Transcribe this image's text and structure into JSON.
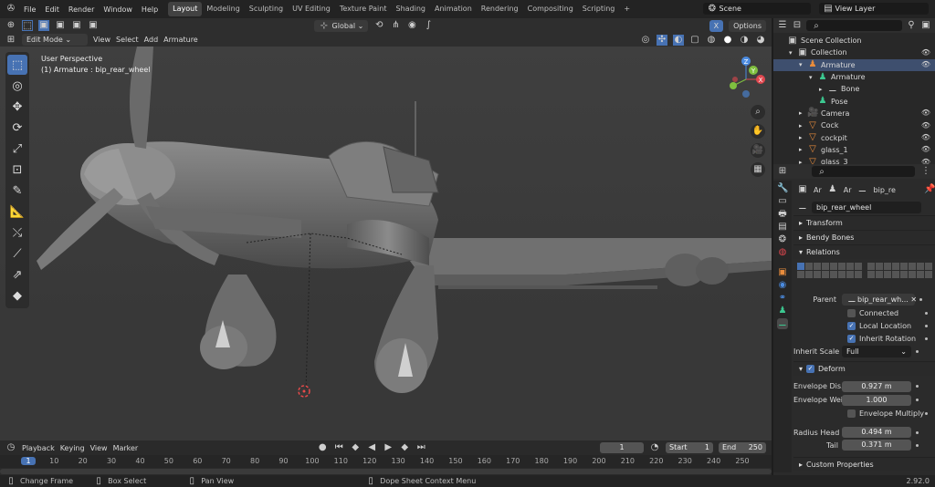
{
  "topbar": {
    "menu": [
      "File",
      "Edit",
      "Render",
      "Window",
      "Help"
    ],
    "workspaces": [
      "Layout",
      "Modeling",
      "Sculpting",
      "UV Editing",
      "Texture Paint",
      "Shading",
      "Animation",
      "Rendering",
      "Compositing",
      "Scripting"
    ],
    "active_workspace": "Layout",
    "add_workspace": "+",
    "scene": "Scene",
    "view_layer": "View Layer"
  },
  "viewport_header": {
    "transform_orientation": "Global",
    "options": "Options",
    "x_label": "X",
    "mode": "Edit Mode",
    "menus": [
      "View",
      "Select",
      "Add",
      "Armature"
    ]
  },
  "viewport": {
    "perspective": "User Perspective",
    "active_object": "(1) Armature : bip_rear_wheel",
    "gizmo": {
      "x": "X",
      "y": "Y",
      "z": "Z"
    }
  },
  "outliner": {
    "items": [
      {
        "label": "Scene Collection",
        "indent": 0
      },
      {
        "label": "Collection",
        "indent": 1
      },
      {
        "label": "Armature",
        "indent": 2,
        "selected": true
      },
      {
        "label": "Armature",
        "indent": 3
      },
      {
        "label": "Bone",
        "indent": 4
      },
      {
        "label": "Pose",
        "indent": 3
      },
      {
        "label": "Camera",
        "indent": 2
      },
      {
        "label": "Cock",
        "indent": 2
      },
      {
        "label": "cockpit",
        "indent": 2
      },
      {
        "label": "glass_1",
        "indent": 2
      },
      {
        "label": "glass_3",
        "indent": 2
      }
    ]
  },
  "properties": {
    "breadcrumb": [
      "Ar",
      "Ar",
      "bip_re"
    ],
    "bone_name": "bip_rear_wheel",
    "panels": {
      "transform": "Transform",
      "bendy": "Bendy Bones",
      "relations": "Relations",
      "deform": "Deform",
      "custom": "Custom Properties"
    },
    "parent_label": "Parent",
    "parent_value": "bip_rear_wh...",
    "connected": "Connected",
    "local_location": "Local Location",
    "inherit_rotation": "Inherit Rotation",
    "inherit_scale_label": "Inherit Scale",
    "inherit_scale_value": "Full",
    "envelope_dist_label": "Envelope Dis...",
    "envelope_dist_value": "0.927 m",
    "envelope_weight_label": "Envelope Wei",
    "envelope_weight_value": "1.000",
    "envelope_multiply": "Envelope Multiply",
    "radius_head_label": "Radius Head",
    "radius_head_value": "0.494 m",
    "tail_label": "Tail",
    "tail_value": "0.371 m"
  },
  "timeline": {
    "menus": [
      "Playback",
      "Keying",
      "View",
      "Marker"
    ],
    "current_frame": "1",
    "start_label": "Start",
    "start": "1",
    "end_label": "End",
    "end": "250",
    "ticks": [
      "1",
      "10",
      "20",
      "30",
      "40",
      "50",
      "60",
      "70",
      "80",
      "90",
      "100",
      "110",
      "120",
      "130",
      "140",
      "150",
      "160",
      "170",
      "180",
      "190",
      "200",
      "210",
      "220",
      "230",
      "240",
      "250"
    ]
  },
  "statusbar": {
    "change_frame": "Change Frame",
    "box_select": "Box Select",
    "pan_view": "Pan View",
    "context_menu": "Dope Sheet Context Menu",
    "version": "2.92.0"
  },
  "colors": {
    "accent": "#4772b3",
    "x_axis": "#e0474f",
    "y_axis": "#7fbf3f",
    "z_axis": "#4b8be0",
    "bone_green": "#3cc890",
    "mesh_orange": "#e88c3c"
  }
}
